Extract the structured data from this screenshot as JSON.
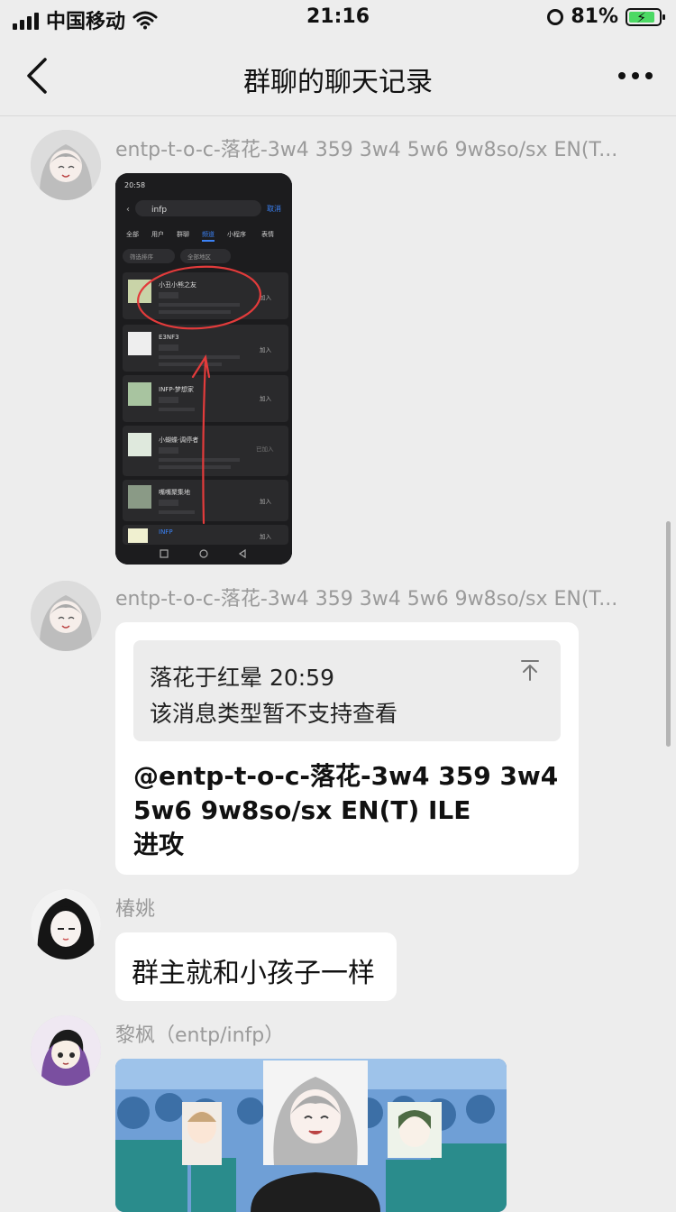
{
  "status_bar": {
    "carrier": "中国移动",
    "time": "21:16",
    "battery": "81%"
  },
  "nav": {
    "title": "群聊的聊天记录"
  },
  "messages": [
    {
      "sender": "entp-t-o-c-落花-3w4 359 3w4 5w6 9w8so/sx EN(T...",
      "type": "image",
      "screenshot": {
        "status_time": "20:58",
        "search_text": "infp",
        "search_cancel": "取消",
        "tabs": [
          "全部",
          "用户",
          "群聊",
          "频道",
          "小程序",
          "表情"
        ],
        "filters": [
          "筛选排序",
          "全部地区"
        ],
        "results": [
          {
            "title": "小丑小熊之友",
            "action": "加入"
          },
          {
            "title": "E3NF3",
            "action": "加入"
          },
          {
            "title": "INFP-梦想家",
            "action": "加入"
          },
          {
            "title": "小蝴蝶·调停者",
            "action": "已加入"
          },
          {
            "title": "嘴嘴聚集地",
            "action": "加入"
          },
          {
            "title": "INFP",
            "action": "加入"
          }
        ]
      }
    },
    {
      "sender": "entp-t-o-c-落花-3w4 359 3w4 5w6 9w8so/sx EN(T...",
      "type": "reply",
      "quote": {
        "line1": "落花于红晕 20:59",
        "line2": "该消息类型暂不支持查看"
      },
      "text": "@entp-t-o-c-落花-3w4 359 3w4\n5w6 9w8so/sx EN(T) ILE\n 进攻"
    },
    {
      "sender": "椿姚",
      "type": "text",
      "text": "群主就和小孩子一样"
    },
    {
      "sender": "黎枫（entp/infp）",
      "type": "image"
    }
  ]
}
